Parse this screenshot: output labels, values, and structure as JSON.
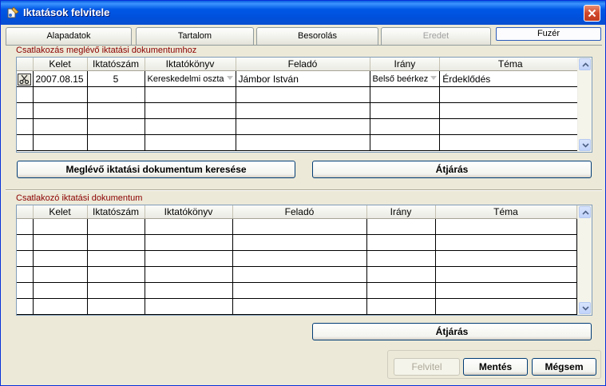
{
  "window": {
    "title": "Iktatások felvitele"
  },
  "tabs": [
    {
      "label": "Alapadatok",
      "state": "normal"
    },
    {
      "label": "Tartalom",
      "state": "normal"
    },
    {
      "label": "Besorolás",
      "state": "normal"
    },
    {
      "label": "Eredet",
      "state": "disabled"
    },
    {
      "label": "Fuzér",
      "state": "active"
    }
  ],
  "section1": {
    "label": "Csatlakozás meglévő iktatási dokumentumhoz",
    "columns": [
      "",
      "Kelet",
      "Iktatószám",
      "Iktatókönyv",
      "Feladó",
      "Irány",
      "Téma"
    ],
    "rows": [
      {
        "kelet": "2007.08.15",
        "iktatoszam": "5",
        "iktatokonyv": "Kereskedelmi oszta",
        "felado": "Jámbor István",
        "irany": "Belső beérkez",
        "tema": "Érdeklődés"
      }
    ],
    "search_button": "Meglévő iktatási dokumentum keresése",
    "jump_button": "Átjárás"
  },
  "section2": {
    "label": "Csatlakozó iktatási dokumentum",
    "columns": [
      "",
      "Kelet",
      "Iktatószám",
      "Iktatókönyv",
      "Feladó",
      "Irány",
      "Téma"
    ],
    "jump_button": "Átjárás"
  },
  "footer": {
    "felvitel": "Felvitel",
    "mentes": "Mentés",
    "megsem": "Mégsem"
  },
  "icons": {
    "app": "document-tool-icon",
    "close": "close-icon",
    "row_select": "scissors-icon"
  },
  "colors": {
    "titlebar": "#0058E6",
    "section_label": "#8B0000",
    "close": "#D2472A"
  }
}
